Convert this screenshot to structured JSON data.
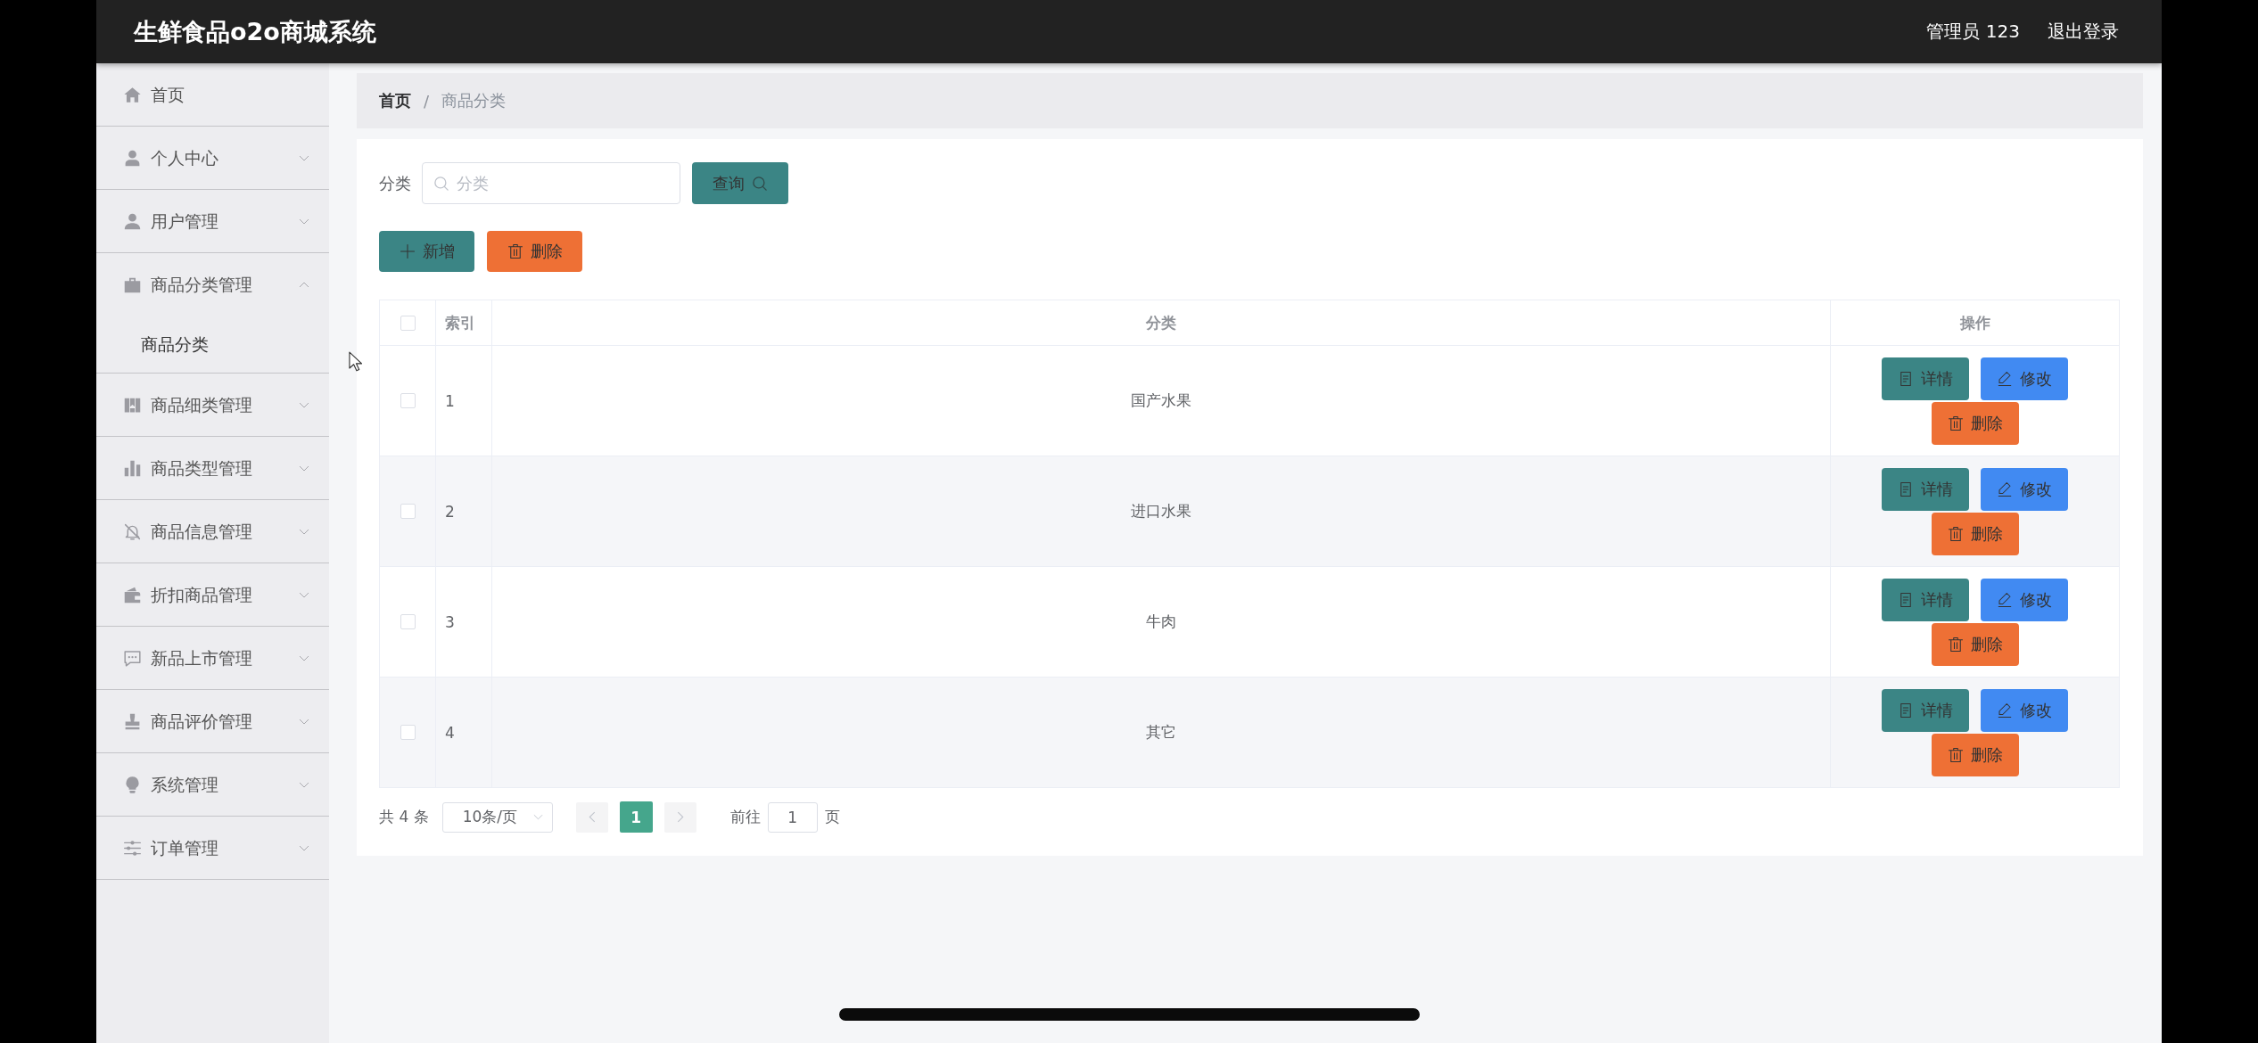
{
  "header": {
    "title": "生鲜食品o2o商城系统",
    "user": "管理员 123",
    "logout": "退出登录"
  },
  "sidebar": {
    "items": [
      {
        "label": "首页",
        "kind": "link"
      },
      {
        "label": "个人中心",
        "kind": "menu",
        "expanded": false
      },
      {
        "label": "用户管理",
        "kind": "menu",
        "expanded": false
      },
      {
        "label": "商品分类管理",
        "kind": "menu",
        "expanded": true,
        "children": [
          {
            "label": "商品分类"
          }
        ]
      },
      {
        "label": "商品细类管理",
        "kind": "menu",
        "expanded": false
      },
      {
        "label": "商品类型管理",
        "kind": "menu",
        "expanded": false
      },
      {
        "label": "商品信息管理",
        "kind": "menu",
        "expanded": false
      },
      {
        "label": "折扣商品管理",
        "kind": "menu",
        "expanded": false
      },
      {
        "label": "新品上市管理",
        "kind": "menu",
        "expanded": false
      },
      {
        "label": "商品评价管理",
        "kind": "menu",
        "expanded": false
      },
      {
        "label": "系统管理",
        "kind": "menu",
        "expanded": false
      },
      {
        "label": "订单管理",
        "kind": "menu",
        "expanded": false
      }
    ]
  },
  "breadcrumb": {
    "items": [
      "首页",
      "商品分类"
    ],
    "separator": "/"
  },
  "search": {
    "label": "分类",
    "placeholder": "分类",
    "button": "查询"
  },
  "toolbar": [
    {
      "label": "新增",
      "kind": "add"
    },
    {
      "label": "删除",
      "kind": "delete"
    }
  ],
  "table": {
    "select_all": {
      "checked": false
    },
    "columns": [
      "索引",
      "分类",
      "操作"
    ],
    "rows": [
      {
        "checked": false,
        "index": "1",
        "category": "国产水果",
        "actions": [
          {
            "label": "详情",
            "kind": "detail"
          },
          {
            "label": "修改",
            "kind": "edit"
          },
          {
            "label": "删除",
            "kind": "delete"
          }
        ]
      },
      {
        "checked": false,
        "index": "2",
        "category": "进口水果",
        "actions": [
          {
            "label": "详情",
            "kind": "detail"
          },
          {
            "label": "修改",
            "kind": "edit"
          },
          {
            "label": "删除",
            "kind": "delete"
          }
        ]
      },
      {
        "checked": false,
        "index": "3",
        "category": "牛肉",
        "actions": [
          {
            "label": "详情",
            "kind": "detail"
          },
          {
            "label": "修改",
            "kind": "edit"
          },
          {
            "label": "删除",
            "kind": "delete"
          }
        ]
      },
      {
        "checked": false,
        "index": "4",
        "category": "其它",
        "actions": [
          {
            "label": "详情",
            "kind": "detail"
          },
          {
            "label": "修改",
            "kind": "edit"
          },
          {
            "label": "删除",
            "kind": "delete"
          }
        ]
      }
    ]
  },
  "pagination": {
    "total": "共 4 条",
    "page_size": "10条/页",
    "prev": {
      "disabled": true
    },
    "pages": [
      {
        "label": "1",
        "selected": true
      }
    ],
    "next": {
      "disabled": true
    },
    "goto_label": "前往",
    "goto_value": "1",
    "goto_suffix": "页"
  }
}
